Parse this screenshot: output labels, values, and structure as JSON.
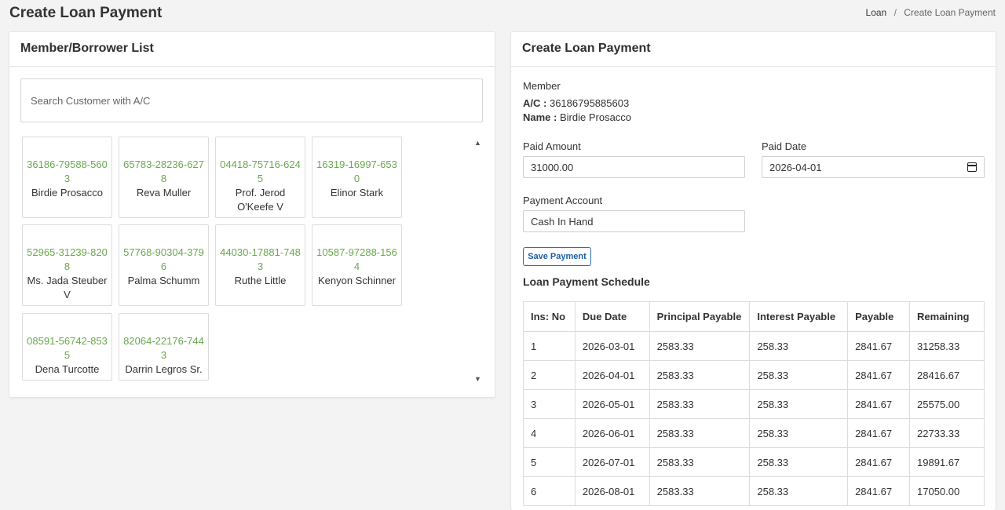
{
  "header": {
    "title": "Create Loan Payment",
    "breadcrumb": [
      "Loan",
      "/",
      "Create Loan Payment"
    ]
  },
  "member_list": {
    "title": "Member/Borrower List",
    "search_placeholder": "Search Customer with A/C",
    "members": [
      {
        "ac": "36186-79588-5603",
        "name": "Birdie Prosacco"
      },
      {
        "ac": "65783-28236-6278",
        "name": "Reva Muller"
      },
      {
        "ac": "04418-75716-6245",
        "name": "Prof. Jerod O'Keefe V"
      },
      {
        "ac": "16319-16997-6530",
        "name": "Elinor Stark"
      },
      {
        "ac": "52965-31239-8208",
        "name": "Ms. Jada Steuber V"
      },
      {
        "ac": "57768-90304-3796",
        "name": "Palma Schumm"
      },
      {
        "ac": "44030-17881-7483",
        "name": "Ruthe Little"
      },
      {
        "ac": "10587-97288-1564",
        "name": "Kenyon Schinner"
      },
      {
        "ac": "08591-56742-8535",
        "name": "Dena Turcotte"
      },
      {
        "ac": "82064-22176-7443",
        "name": "Darrin Legros Sr."
      }
    ]
  },
  "payment_form": {
    "title": "Create Loan Payment",
    "member_label": "Member",
    "ac_label": "A/C :",
    "ac_value": "36186795885603",
    "name_label": "Name :",
    "name_value": "Birdie Prosacco",
    "paid_amount_label": "Paid Amount",
    "paid_amount_value": "31000.00",
    "paid_date_label": "Paid Date",
    "paid_date_value": "2026-04-01",
    "payment_account_label": "Payment Account",
    "payment_account_value": "Cash In Hand",
    "save_label": "Save Payment"
  },
  "schedule": {
    "title": "Loan Payment Schedule",
    "columns": [
      "Ins: No",
      "Due Date",
      "Principal Payable",
      "Interest Payable",
      "Payable",
      "Remaining"
    ],
    "rows": [
      [
        "1",
        "2026-03-01",
        "2583.33",
        "258.33",
        "2841.67",
        "31258.33"
      ],
      [
        "2",
        "2026-04-01",
        "2583.33",
        "258.33",
        "2841.67",
        "28416.67"
      ],
      [
        "3",
        "2026-05-01",
        "2583.33",
        "258.33",
        "2841.67",
        "25575.00"
      ],
      [
        "4",
        "2026-06-01",
        "2583.33",
        "258.33",
        "2841.67",
        "22733.33"
      ],
      [
        "5",
        "2026-07-01",
        "2583.33",
        "258.33",
        "2841.67",
        "19891.67"
      ],
      [
        "6",
        "2026-08-01",
        "2583.33",
        "258.33",
        "2841.67",
        "17050.00"
      ]
    ]
  }
}
